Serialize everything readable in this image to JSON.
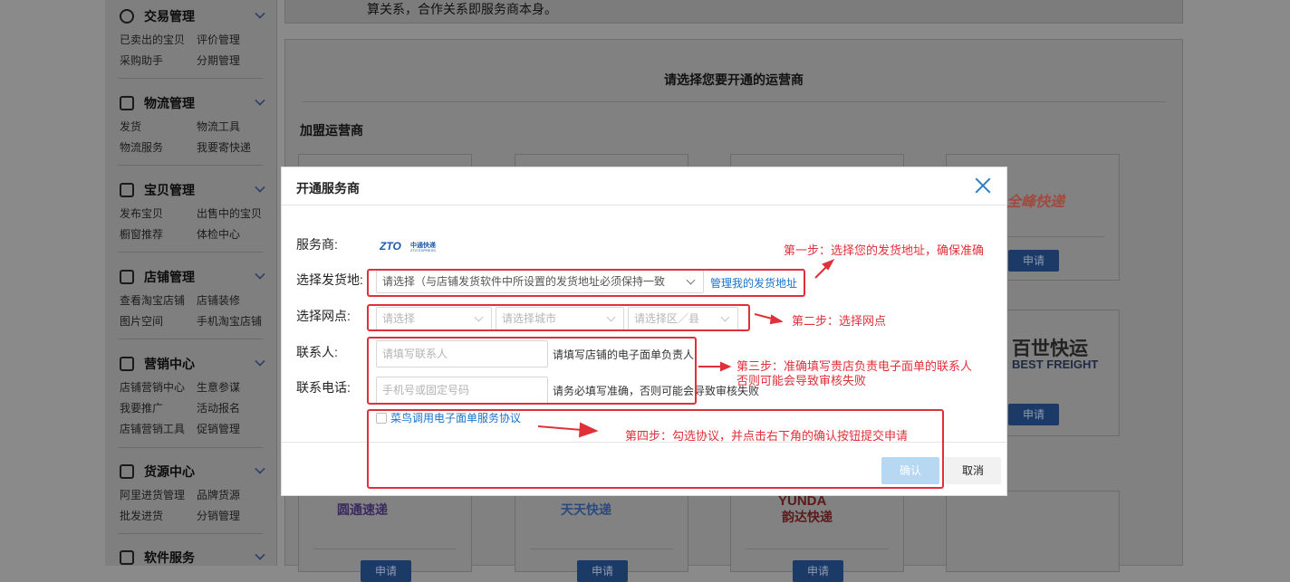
{
  "sidebar": {
    "groups": [
      {
        "title": "交易管理",
        "icon": "yen-circle-icon",
        "items": [
          "已卖出的宝贝",
          "评价管理",
          "采购助手",
          "分期管理"
        ]
      },
      {
        "title": "物流管理",
        "icon": "truck-icon",
        "items": [
          "发货",
          "物流工具",
          "物流服务",
          "我要寄快递"
        ]
      },
      {
        "title": "宝贝管理",
        "icon": "bag-icon",
        "items": [
          "发布宝贝",
          "出售中的宝贝",
          "橱窗推荐",
          "体检中心"
        ]
      },
      {
        "title": "店铺管理",
        "icon": "shop-icon",
        "items": [
          "查看淘宝店铺",
          "店铺装修",
          "图片空间",
          "手机淘宝店铺"
        ]
      },
      {
        "title": "营销中心",
        "icon": "megaphone-icon",
        "items": [
          "店铺营销中心",
          "生意参谋",
          "我要推广",
          "活动报名",
          "店铺营销工具",
          "促销管理"
        ]
      },
      {
        "title": "货源中心",
        "icon": "box-icon",
        "items": [
          "阿里进货管理",
          "品牌货源",
          "批发进货",
          "分销管理"
        ]
      },
      {
        "title": "软件服务",
        "icon": "grid-icon",
        "items": []
      }
    ]
  },
  "page": {
    "top_text": "算关系，合作关系即服务商本身。",
    "panel_title": "请选择您要开通的运营商",
    "section_title": "加盟运营商",
    "apply_label": "申请",
    "logos": {
      "qf": "全峰快递",
      "best_cn": "百世快运",
      "best_en": "BEST FREIGHT",
      "yt": "圆通速递",
      "tt": "天天快递",
      "yunda_en": "YUNDA",
      "yunda_cn": "韵达快递"
    }
  },
  "modal": {
    "title": "开通服务商",
    "provider_label": "服务商:",
    "provider_logo": "ZTO 中通快递",
    "address_label": "选择发货地:",
    "address_select": "请选择（与店铺发货软件中所设置的发货地址必须保持一致",
    "manage_address_link": "管理我的发货地址",
    "outlet_label": "选择网点:",
    "outlet_province": "请选择",
    "outlet_city": "请选择城市",
    "outlet_district": "请选择区／县",
    "contact_label": "联系人:",
    "contact_placeholder": "请填写联系人",
    "contact_hint": "请填写店铺的电子面单负责人",
    "phone_label": "联系电话:",
    "phone_placeholder": "手机号或固定号码",
    "phone_hint": "请务必填写准确，否则可能会导致审核失败",
    "agreement": "菜鸟调用电子面单服务协议",
    "confirm_label": "确认",
    "cancel_label": "取消"
  },
  "annotations": {
    "step1": "第一步：选择您的发货地址，确保准确",
    "step2": "第二步：选择网点",
    "step3_line1": "第三步：准确填写贵店负责电子面单的联系人",
    "step3_line2": "否则可能会导致审核失败",
    "step4": "第四步：勾选协议，并点击右下角的确认按钮提交申请",
    "color": "#e0303a"
  }
}
